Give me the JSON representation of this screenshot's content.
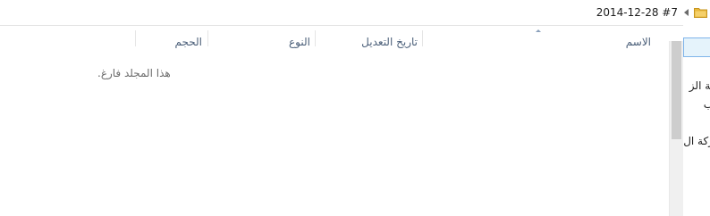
{
  "address_bar": {
    "path_text": "2014-12-28 #7",
    "chevron_icon": "chevron-left-icon",
    "folder_icon": "folder-icon"
  },
  "columns": {
    "name": "الاسم",
    "date_modified": "تاريخ التعديل",
    "type": "النوع",
    "size": "الحجم",
    "sorted_column": "name",
    "sort_direction": "ascending"
  },
  "content": {
    "empty_message": "هذا المجلد فارغ."
  },
  "navigation_pane": {
    "items": [
      {
        "label": "ئة الز"
      },
      {
        "label": "ب"
      },
      {
        "label": "ركة ال"
      }
    ]
  },
  "colors": {
    "header_text": "#4c607a",
    "selection_bg": "#e5f3fb",
    "selection_border": "#7eb4ea",
    "folder_yellow": "#e8b83b"
  }
}
